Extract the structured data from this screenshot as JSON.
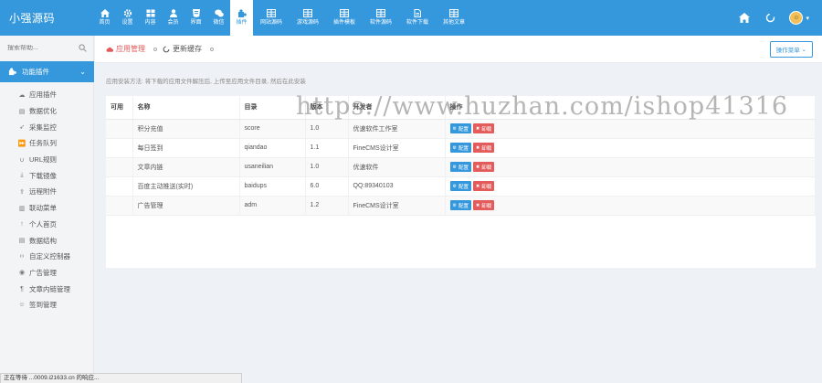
{
  "app": {
    "brand": "小强源码"
  },
  "topnav": [
    {
      "label": "首页",
      "icon": "home-icon"
    },
    {
      "label": "设置",
      "icon": "gear-icon"
    },
    {
      "label": "内容",
      "icon": "th-icon"
    },
    {
      "label": "会员",
      "icon": "user-icon"
    },
    {
      "label": "界面",
      "icon": "html5-icon"
    },
    {
      "label": "微信",
      "icon": "wechat-icon"
    },
    {
      "label": "插件",
      "icon": "puzzle-icon",
      "active": true
    },
    {
      "label": "网站源码",
      "icon": "table-icon"
    },
    {
      "label": "游戏源码",
      "icon": "table-icon"
    },
    {
      "label": "插件模板",
      "icon": "table-icon"
    },
    {
      "label": "软件源码",
      "icon": "table-icon"
    },
    {
      "label": "软件下载",
      "icon": "file-icon"
    },
    {
      "label": "其他文章",
      "icon": "table-icon"
    }
  ],
  "sidebar": {
    "search_placeholder": "搜索帮助...",
    "group_label": "功能插件",
    "items": [
      {
        "label": "应用插件",
        "icon": "cloud-icon"
      },
      {
        "label": "数据优化",
        "icon": "database-icon"
      },
      {
        "label": "采集监控",
        "icon": "cursor-icon"
      },
      {
        "label": "任务队列",
        "icon": "forward-icon"
      },
      {
        "label": "URL规则",
        "icon": "link-icon"
      },
      {
        "label": "下载镜像",
        "icon": "download-icon"
      },
      {
        "label": "远程附件",
        "icon": "upload-icon"
      },
      {
        "label": "联动菜单",
        "icon": "columns-icon"
      },
      {
        "label": "个人首页",
        "icon": "arrow-up-icon"
      },
      {
        "label": "数据结构",
        "icon": "database-icon"
      },
      {
        "label": "自定义控制器",
        "icon": "code-icon"
      },
      {
        "label": "广告管理",
        "icon": "eye-icon"
      },
      {
        "label": "文章内链管理",
        "icon": "paragraph-icon"
      },
      {
        "label": "签到管理",
        "icon": "user-outline-icon"
      }
    ]
  },
  "page": {
    "crumb_active": "应用管理",
    "crumb_refresh": "更新缓存",
    "op_button": "操作菜单",
    "hint": "应用安装方法: 将下载的应用文件解压后, 上传至应用文件目录, 然后在此安装"
  },
  "table": {
    "headers": [
      "可用",
      "名称",
      "目录",
      "版本",
      "开发者",
      "操作"
    ],
    "rows": [
      {
        "enabled": "",
        "name": "积分充值",
        "dir": "score",
        "version": "1.0",
        "author": "优速软件工作室",
        "btn1": "配置",
        "btn2": "卸载",
        "installed": true
      },
      {
        "enabled": "",
        "name": "每日签到",
        "dir": "qiandao",
        "version": "1.1",
        "author": "FineCMS设计室",
        "btn1": "配置",
        "btn2": "卸载",
        "installed": true
      },
      {
        "enabled": "",
        "name": "文章内链",
        "dir": "usaneilian",
        "version": "1.0",
        "author": "优速软件",
        "btn1": "配置",
        "btn2": "卸载",
        "installed": true
      },
      {
        "enabled": "",
        "name": "百度主动推送(实时)",
        "dir": "baidups",
        "version": "6.0",
        "author": "QQ:89340103",
        "btn1": "配置",
        "btn2": "卸载",
        "installed": true
      },
      {
        "enabled": "",
        "name": "广告管理",
        "dir": "adm",
        "version": "1.2",
        "author": "FineCMS设计室",
        "btn1": "配置",
        "btn2": "卸载",
        "installed": true
      }
    ]
  },
  "status_text": "正在等待 ...0009.i21633.cn 的响应...",
  "watermark": "https://www.huzhan.com/ishop41316",
  "colors": {
    "primary": "#3598dc",
    "danger": "#e35b5a",
    "active_crumb": "#e25b5b"
  }
}
